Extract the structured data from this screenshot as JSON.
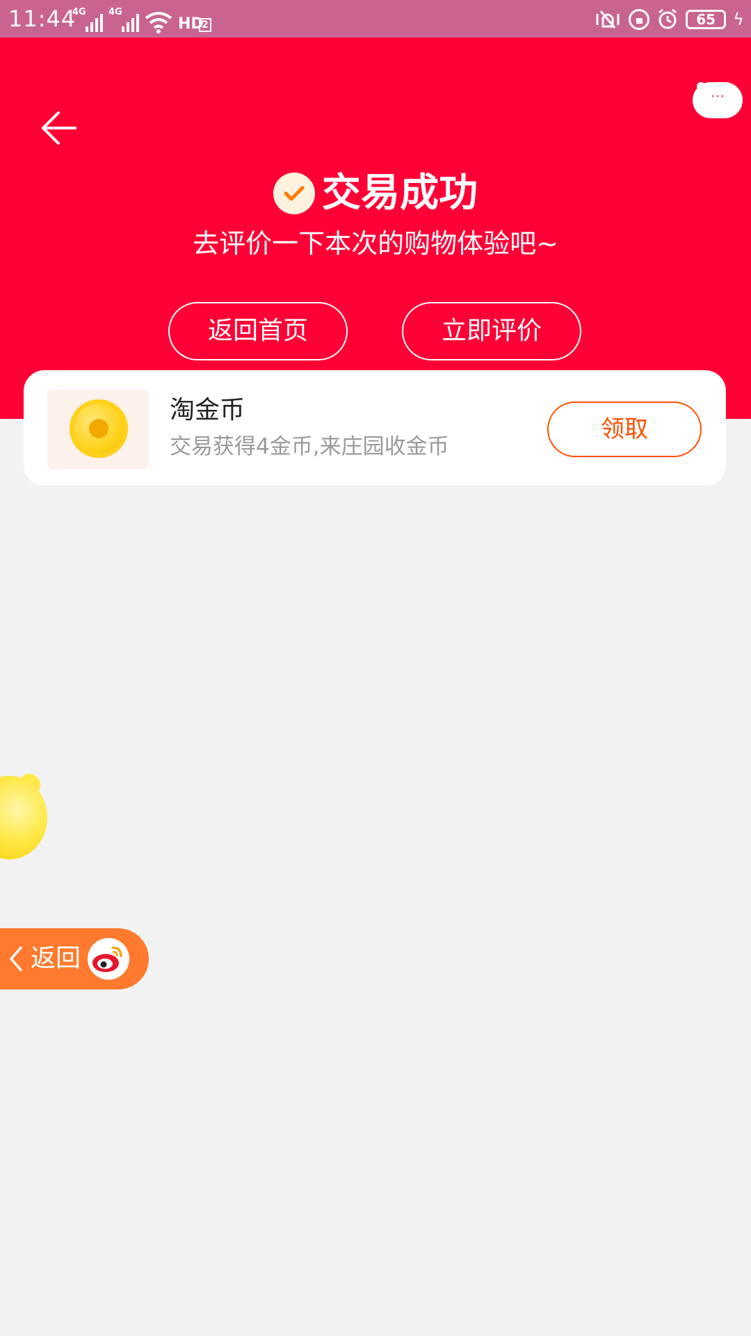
{
  "status_bar": {
    "time": "11:44",
    "network_1": "4G",
    "network_2": "4G",
    "hd": "HD",
    "hd_sub": "2",
    "battery": "65"
  },
  "header": {
    "title": "交易成功",
    "subtitle": "去评价一下本次的购物体验吧~",
    "home_button": "返回首页",
    "review_button": "立即评价",
    "more_label": "···"
  },
  "coin_card": {
    "title": "淘金币",
    "description": "交易获得4金币,来庄园收金币",
    "claim_button": "领取"
  },
  "floating": {
    "return_label": "返回"
  },
  "colors": {
    "header_red": "#ff0036",
    "status_bar": "#c96490",
    "claim_orange": "#ff5000",
    "return_pill": "#ff7a2e"
  },
  "icons": [
    "back-arrow-icon",
    "more-icon",
    "check-icon",
    "gold-coin-icon",
    "piggy-bank-icon",
    "chevron-left-icon",
    "weibo-logo-icon"
  ]
}
